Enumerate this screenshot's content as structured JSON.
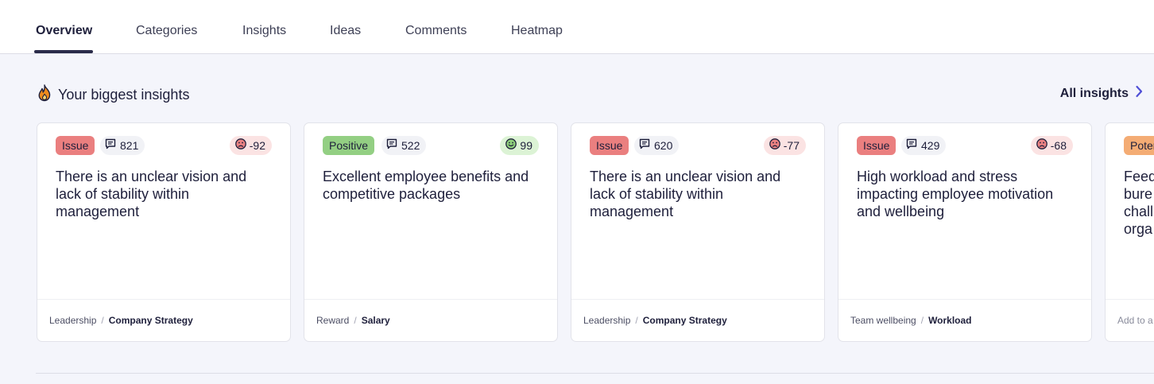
{
  "tabs": [
    {
      "label": "Overview",
      "active": true
    },
    {
      "label": "Categories",
      "active": false
    },
    {
      "label": "Insights",
      "active": false
    },
    {
      "label": "Ideas",
      "active": false
    },
    {
      "label": "Comments",
      "active": false
    },
    {
      "label": "Heatmap",
      "active": false
    }
  ],
  "section": {
    "title": "Your biggest insights",
    "icon": "flame-icon",
    "all_link": "All insights"
  },
  "cards": [
    {
      "badge": "Issue",
      "count": "821",
      "score": "-92",
      "sentiment": "negative",
      "title": "There is an unclear vision and lack of stability within management",
      "category": "Leadership",
      "subcategory": "Company Strategy"
    },
    {
      "badge": "Positive",
      "count": "522",
      "score": "99",
      "sentiment": "positive",
      "title": "Excellent employee benefits and competitive packages",
      "category": "Reward",
      "subcategory": "Salary"
    },
    {
      "badge": "Issue",
      "count": "620",
      "score": "-77",
      "sentiment": "negative",
      "title": "There is an unclear vision and lack of stability within management",
      "category": "Leadership",
      "subcategory": "Company Strategy"
    },
    {
      "badge": "Issue",
      "count": "429",
      "score": "-68",
      "sentiment": "negative",
      "title": "High workload and stress impacting employee motivation and wellbeing",
      "category": "Team wellbeing",
      "subcategory": "Workload"
    },
    {
      "badge": "Poter",
      "title": "Feed bure chall orga",
      "footer": "Add to a"
    }
  ],
  "colors": {
    "issue": "#ea7f7f",
    "positive": "#93cf83",
    "potential": "#f4ac74",
    "text": "#1e1f3b",
    "accent_link": "#4f4fd6"
  }
}
